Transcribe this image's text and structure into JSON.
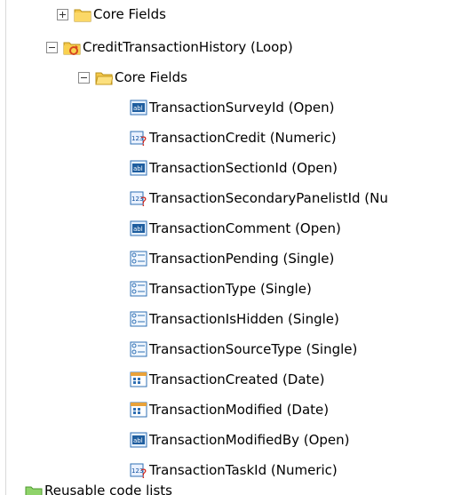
{
  "tree": {
    "top_partial": {
      "label": "Core Fields"
    },
    "loop": {
      "label": "CreditTransactionHistory (Loop)"
    },
    "core_fields": {
      "label": "Core Fields"
    },
    "fields": [
      {
        "label": "TransactionSurveyId (Open)",
        "type": "open"
      },
      {
        "label": "TransactionCredit (Numeric)",
        "type": "numeric"
      },
      {
        "label": "TransactionSectionId (Open)",
        "type": "open"
      },
      {
        "label": "TransactionSecondaryPanelistId (Nu",
        "type": "numeric"
      },
      {
        "label": "TransactionComment (Open)",
        "type": "open"
      },
      {
        "label": "TransactionPending (Single)",
        "type": "single"
      },
      {
        "label": "TransactionType (Single)",
        "type": "single"
      },
      {
        "label": "TransactionIsHidden (Single)",
        "type": "single"
      },
      {
        "label": "TransactionSourceType (Single)",
        "type": "single"
      },
      {
        "label": "TransactionCreated (Date)",
        "type": "date"
      },
      {
        "label": "TransactionModified (Date)",
        "type": "date"
      },
      {
        "label": "TransactionModifiedBy (Open)",
        "type": "open"
      },
      {
        "label": "TransactionTaskId (Numeric)",
        "type": "numeric"
      }
    ],
    "bottom_partial": {
      "label": "Reusable code lists"
    }
  }
}
